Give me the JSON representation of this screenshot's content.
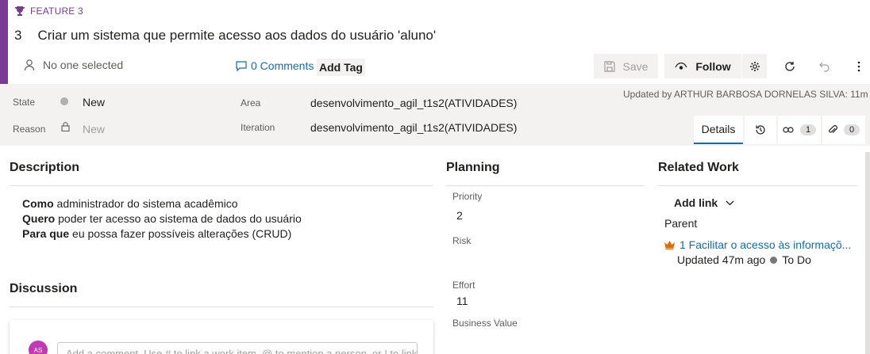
{
  "work_item": {
    "type_label": "FEATURE 3",
    "id": "3",
    "title": "Criar um sistema que permite acesso aos dados do usuário 'aluno'",
    "accent_color": "#773b93"
  },
  "meta": {
    "assigned_to": "No one selected",
    "comments_label": "0 Comments",
    "add_tag_label": "Add Tag"
  },
  "toolbar": {
    "save_label": "Save",
    "follow_label": "Follow",
    "icons": [
      "save-icon",
      "eye-icon",
      "gear-icon",
      "refresh-icon",
      "undo-icon",
      "more-icon"
    ]
  },
  "fields": {
    "state_label": "State",
    "state_value": "New",
    "reason_label": "Reason",
    "reason_value": "New",
    "area_label": "Area",
    "area_value": "desenvolvimento_agil_t1s2(ATIVIDADES)",
    "iteration_label": "Iteration",
    "iteration_value": "desenvolvimento_agil_t1s2(ATIVIDADES)",
    "updated_by": "Updated by ARTHUR BARBOSA DORNELAS SILVA: 11m ago"
  },
  "tabs": {
    "details_label": "Details",
    "links_count": "1",
    "attachments_count": "0"
  },
  "description": {
    "title": "Description",
    "lines": [
      {
        "bold": "Como",
        "text": " administrador do sistema acadêmico"
      },
      {
        "bold": "Quero",
        "text": " poder ter acesso ao sistema de dados do usuário"
      },
      {
        "bold": "Para que",
        "text": " eu possa fazer possíveis alterações (CRUD)"
      }
    ]
  },
  "discussion": {
    "title": "Discussion",
    "avatar_initials": "AS",
    "comment_placeholder": "Add a comment. Use # to link a work item, @ to mention a person, or ! to link a pull request."
  },
  "planning": {
    "title": "Planning",
    "priority_label": "Priority",
    "priority_value": "2",
    "risk_label": "Risk",
    "effort_label": "Effort",
    "effort_value": "11",
    "business_value_label": "Business Value"
  },
  "related_work": {
    "title": "Related Work",
    "add_link_label": "Add link",
    "parent_label": "Parent",
    "parent_item": "1 Facilitar o acesso às informaçõ...",
    "parent_updated": "Updated 47m ago",
    "parent_status": "To Do"
  }
}
